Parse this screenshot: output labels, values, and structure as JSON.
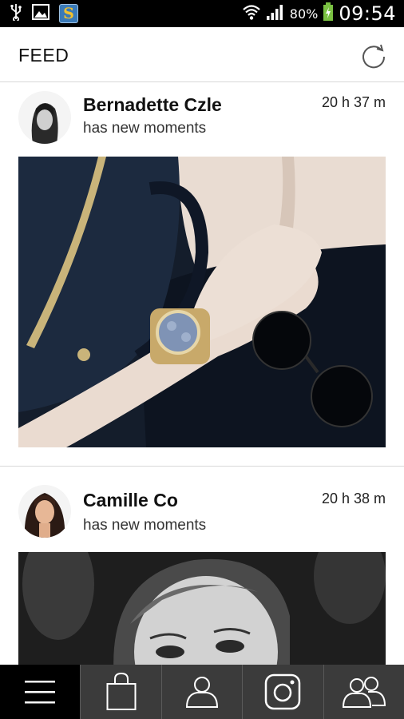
{
  "status_bar": {
    "battery_percent": "80%",
    "time": "09:54",
    "icons": [
      "usb-icon",
      "gallery-icon",
      "app-s-icon",
      "wifi-icon",
      "signal-icon",
      "battery-charging-icon"
    ],
    "app_letter": "S"
  },
  "header": {
    "title": "FEED",
    "refresh_icon": "refresh-icon"
  },
  "feed": {
    "posts": [
      {
        "user": "Bernadette Czle",
        "subtitle": "has new moments",
        "time": "20 h 37 m"
      },
      {
        "user": "Camille Co",
        "subtitle": "has new moments",
        "time": "20 h 38 m"
      }
    ]
  },
  "bottom_nav": {
    "items": [
      {
        "icon": "menu-icon",
        "active": true
      },
      {
        "icon": "shopping-bag-icon",
        "active": false
      },
      {
        "icon": "profile-icon",
        "active": false
      },
      {
        "icon": "instagram-icon",
        "active": false
      },
      {
        "icon": "friends-icon",
        "active": false
      }
    ]
  },
  "colors": {
    "status_bar": "#000000",
    "nav_background": "#3b3b3b",
    "nav_active": "#000000",
    "battery_charging": "#7ac142"
  }
}
